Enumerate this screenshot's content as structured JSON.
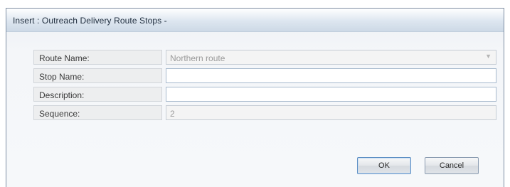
{
  "dialog": {
    "title": "Insert : Outreach Delivery Route Stops -"
  },
  "form": {
    "fields": [
      {
        "label": "Route Name:",
        "value": "Northern route"
      },
      {
        "label": "Stop Name:",
        "value": ""
      },
      {
        "label": "Description:",
        "value": ""
      },
      {
        "label": "Sequence:",
        "value": "2"
      }
    ]
  },
  "buttons": {
    "ok_label": "OK",
    "cancel_label": "Cancel"
  },
  "icons": {
    "dropdown": "chevron-down-icon"
  }
}
